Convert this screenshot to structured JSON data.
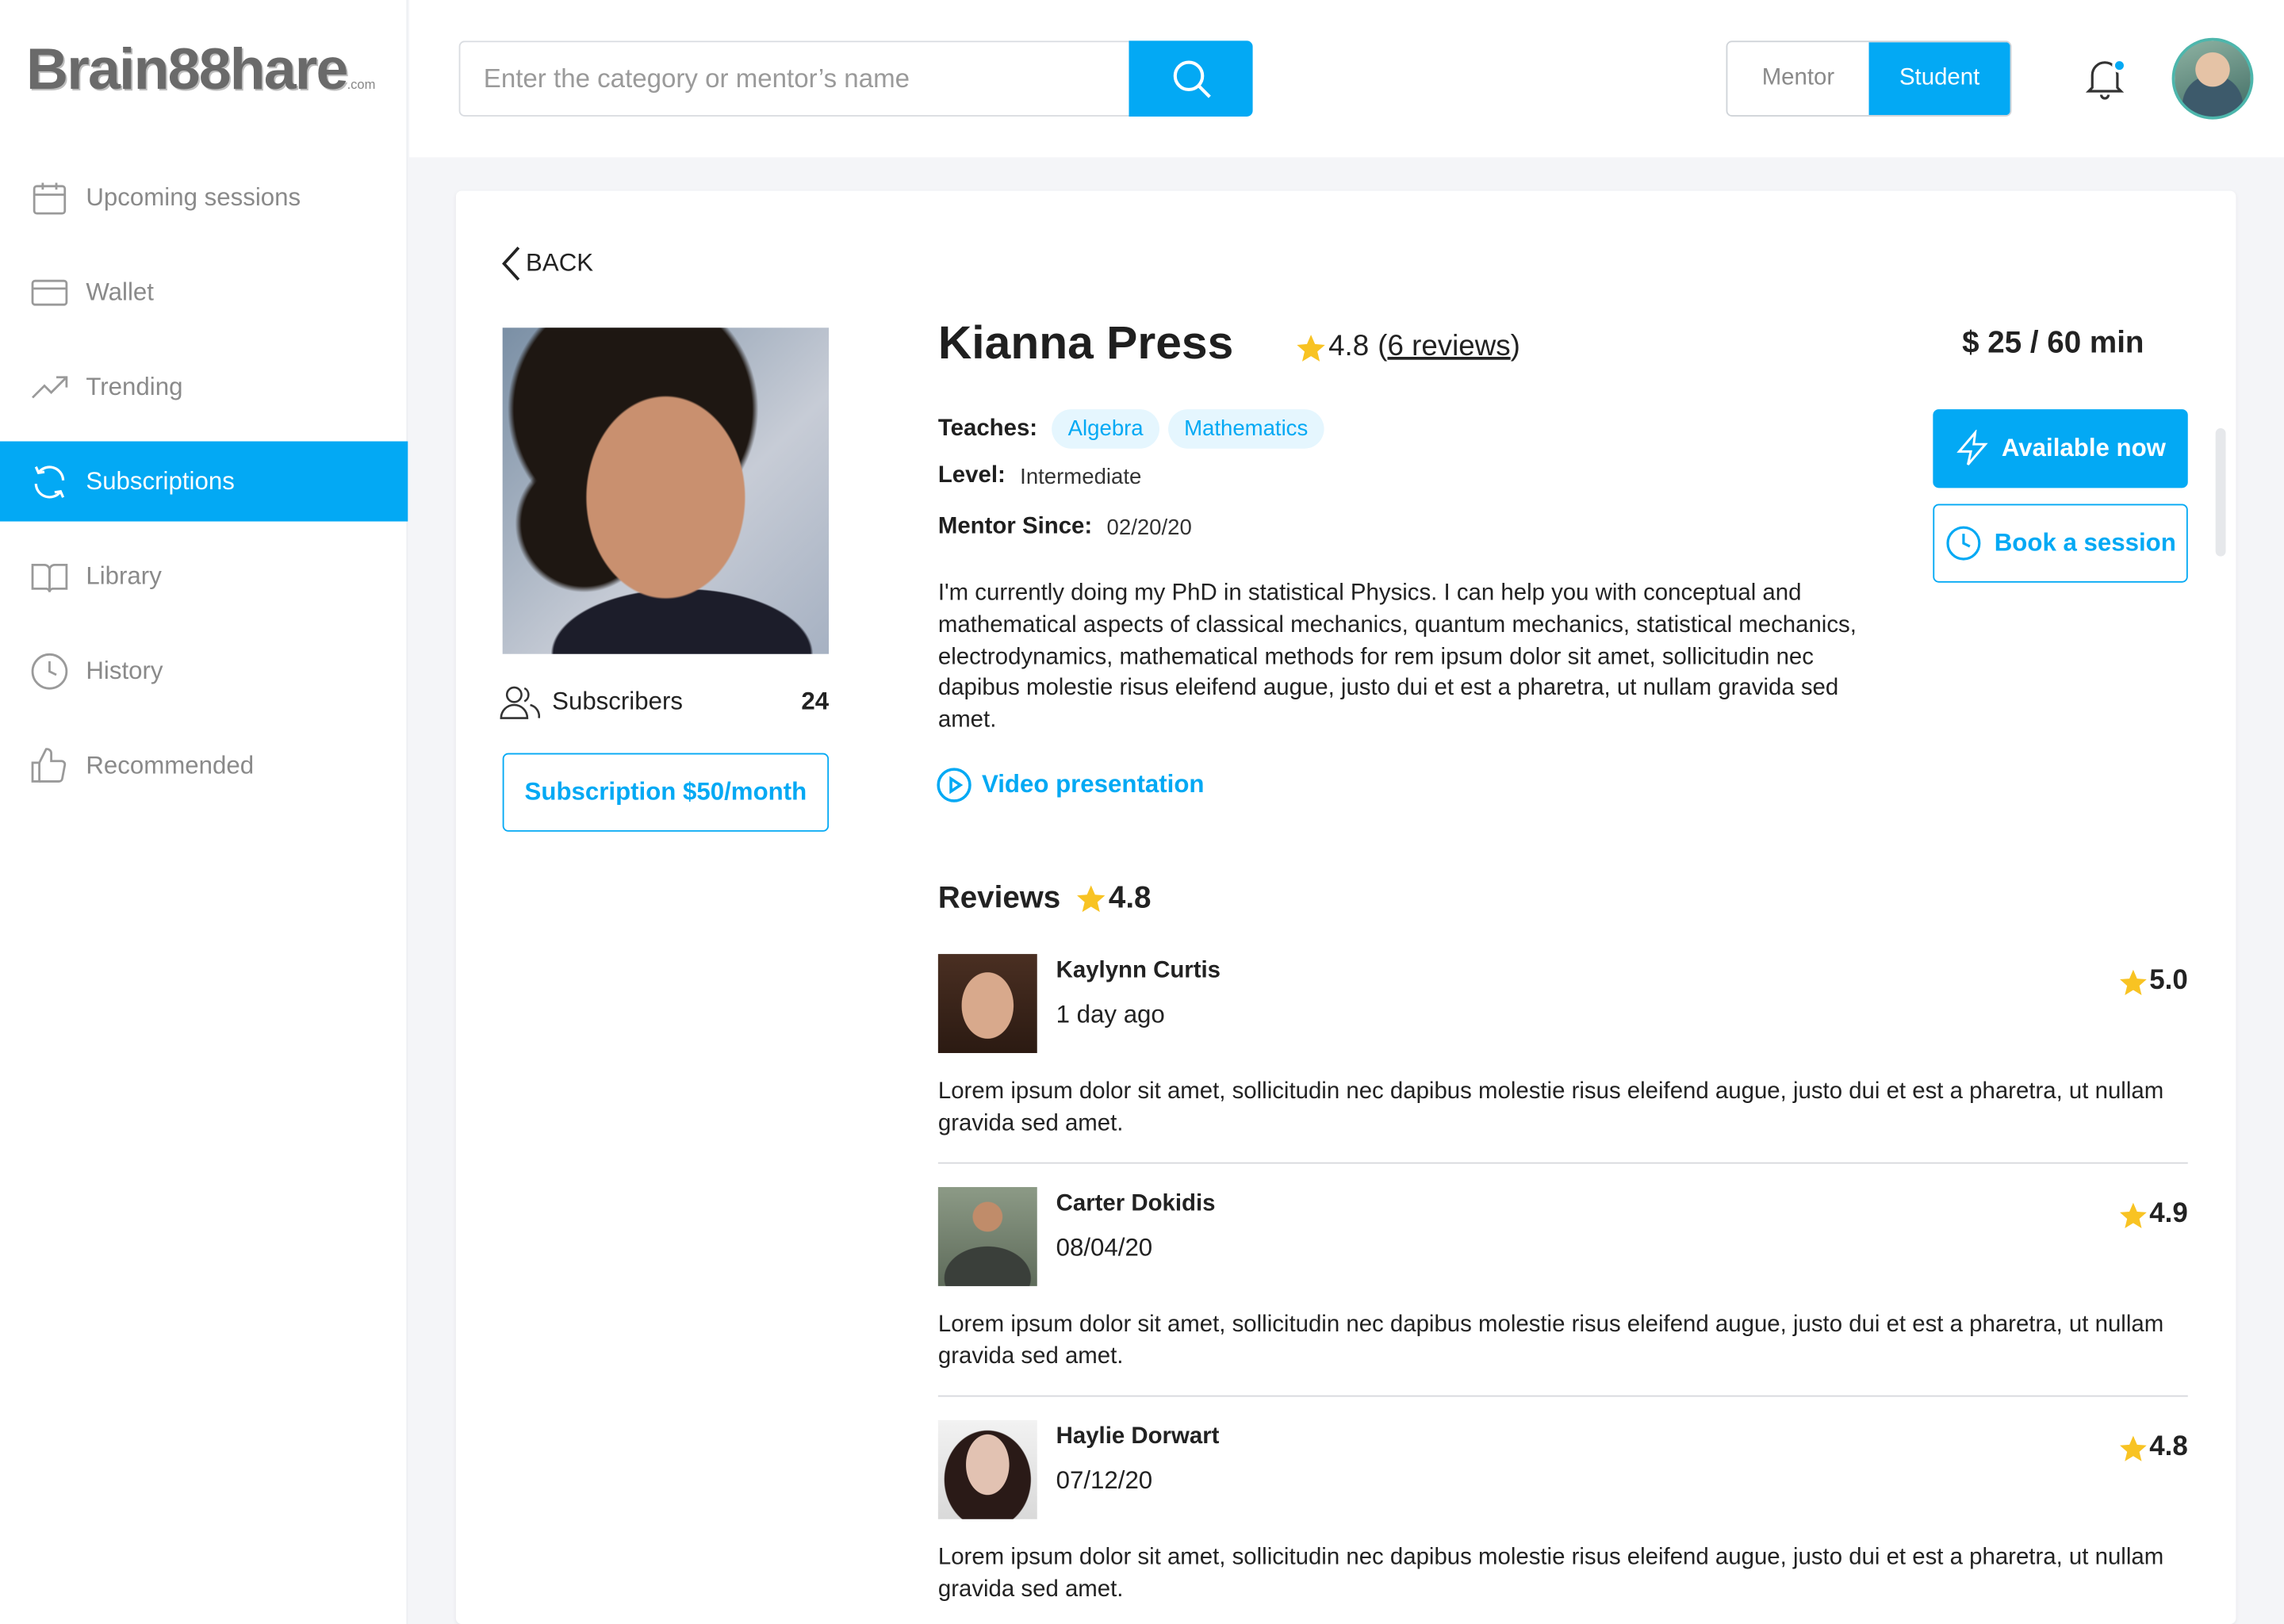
{
  "brand": {
    "logo_text": "Brain88hare",
    "logo_domain": ".com"
  },
  "sidebar": {
    "items": [
      {
        "label": "Upcoming sessions",
        "icon": "calendar-icon"
      },
      {
        "label": "Wallet",
        "icon": "card-icon"
      },
      {
        "label": "Trending",
        "icon": "trend-icon"
      },
      {
        "label": "Subscriptions",
        "icon": "refresh-icon",
        "active": true
      },
      {
        "label": "Library",
        "icon": "book-icon"
      },
      {
        "label": "History",
        "icon": "clock-icon"
      },
      {
        "label": "Recommended",
        "icon": "thumbs-up-icon"
      }
    ]
  },
  "header": {
    "search_placeholder": "Enter the category or mentor’s name",
    "toggle": {
      "mentor": "Mentor",
      "student": "Student",
      "selected": "Student"
    }
  },
  "profile": {
    "back_label": "BACK",
    "name": "Kianna Press",
    "rating": "4.8",
    "reviews_link": "6 reviews",
    "price": "$ 25 / 60 min",
    "teaches_label": "Teaches:",
    "tags": [
      "Algebra",
      "Mathematics"
    ],
    "level_label": "Level:",
    "level": "Intermediate",
    "mentor_since_label": "Mentor Since:",
    "mentor_since": "02/20/20",
    "bio": "I'm currently doing my PhD in statistical Physics. I can help you with conceptual and mathematical aspects of classical mechanics, quantum mechanics, statistical mechanics, electrodynamics, mathematical methods for rem ipsum dolor sit amet, sollicitudin nec dapibus molestie risus eleifend augue, justo dui et est a pharetra, ut nullam gravida sed amet.",
    "video_label": "Video presentation",
    "subscribers_label": "Subscribers",
    "subscribers_count": "24",
    "subscription_button": "Subscription $50/month",
    "available_button": "Available now",
    "book_button": "Book a session"
  },
  "reviews": {
    "title": "Reviews",
    "average": "4.8",
    "items": [
      {
        "name": "Kaylynn Curtis",
        "date": "1 day ago",
        "score": "5.0",
        "text": "Lorem ipsum dolor sit amet, sollicitudin nec dapibus molestie risus eleifend augue, justo dui et est a pharetra, ut nullam gravida sed amet."
      },
      {
        "name": "Carter Dokidis",
        "date": "08/04/20",
        "score": "4.9",
        "text": "Lorem ipsum dolor sit amet, sollicitudin nec dapibus molestie risus eleifend augue, justo dui et est a pharetra, ut nullam gravida sed amet."
      },
      {
        "name": "Haylie Dorwart",
        "date": "07/12/20",
        "score": "4.8",
        "text": "Lorem ipsum dolor sit amet, sollicitudin nec dapibus molestie risus eleifend augue, justo dui et est a pharetra, ut nullam gravida sed amet."
      }
    ]
  },
  "colors": {
    "accent": "#03a9f4",
    "star": "#f8c323",
    "tag_bg": "#e5f6fe"
  }
}
